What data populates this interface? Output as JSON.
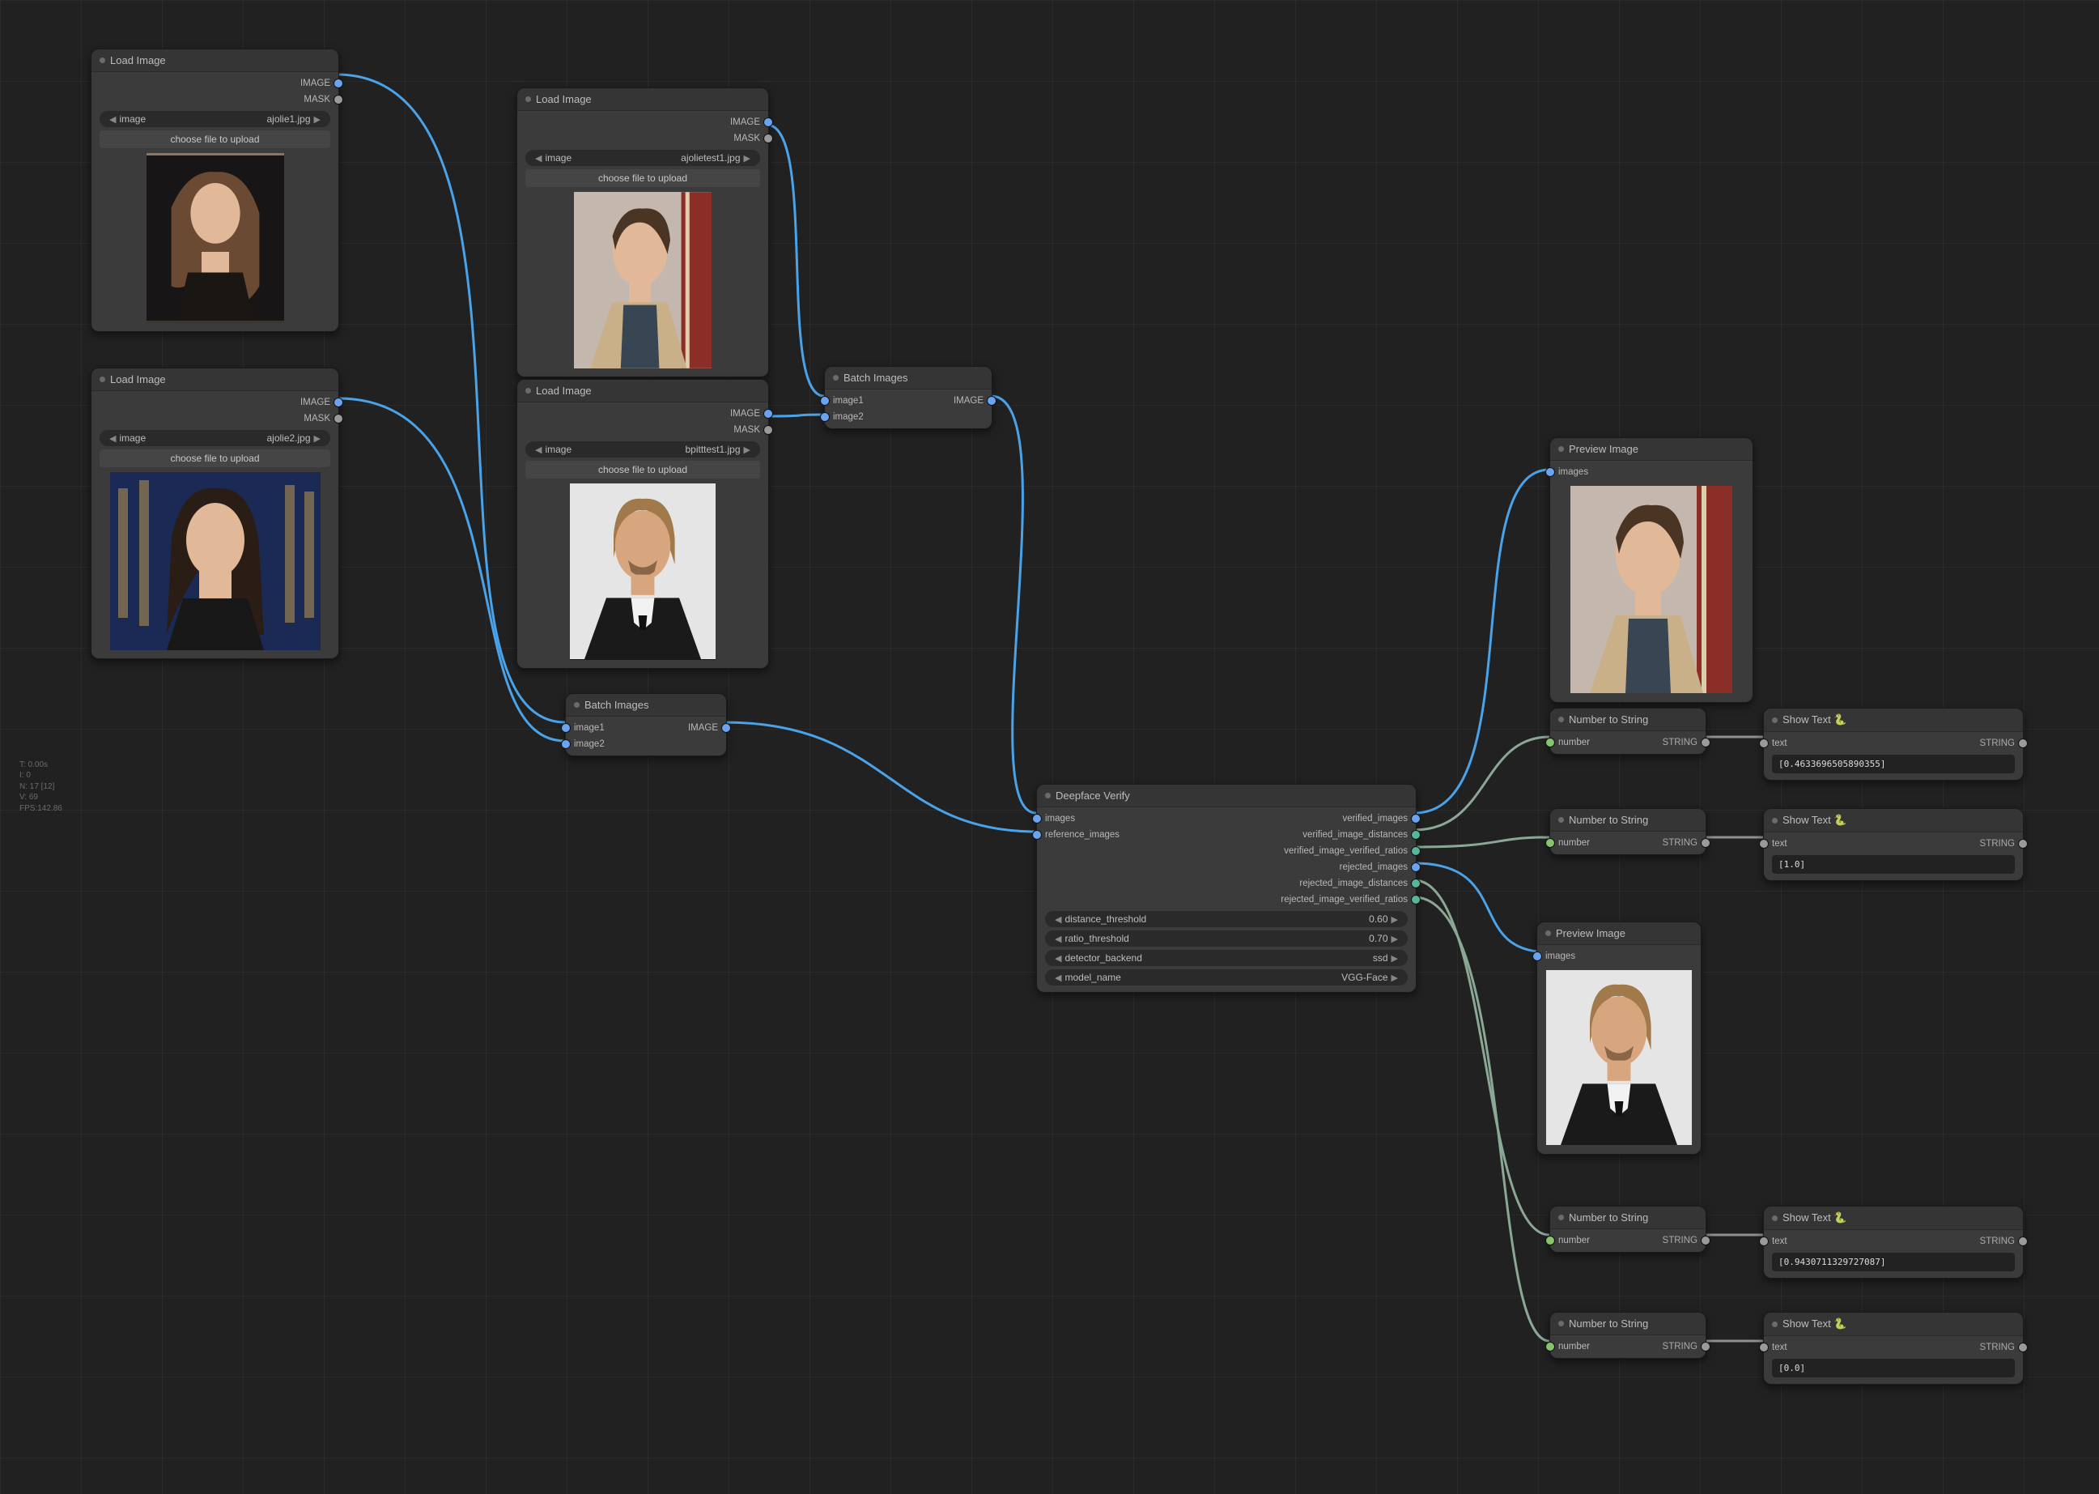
{
  "debug": {
    "t": "T: 0.00s",
    "i": "I: 0",
    "n": "N: 17 [12]",
    "v": "V: 69",
    "fps": "FPS:142.86"
  },
  "nodes": {
    "load1": {
      "title": "Load Image",
      "image_label": "image",
      "file": "ajolie1.jpg",
      "upload": "choose file to upload",
      "out_image": "IMAGE",
      "out_mask": "MASK"
    },
    "load2": {
      "title": "Load Image",
      "image_label": "image",
      "file": "ajolie2.jpg",
      "upload": "choose file to upload",
      "out_image": "IMAGE",
      "out_mask": "MASK"
    },
    "load3": {
      "title": "Load Image",
      "image_label": "image",
      "file": "ajolietest1.jpg",
      "upload": "choose file to upload",
      "out_image": "IMAGE",
      "out_mask": "MASK"
    },
    "load4": {
      "title": "Load Image",
      "image_label": "image",
      "file": "bpitttest1.jpg",
      "upload": "choose file to upload",
      "out_image": "IMAGE",
      "out_mask": "MASK"
    },
    "batch1": {
      "title": "Batch Images",
      "in1": "image1",
      "in2": "image2",
      "out": "IMAGE"
    },
    "batch2": {
      "title": "Batch Images",
      "in1": "image1",
      "in2": "image2",
      "out": "IMAGE"
    },
    "verify": {
      "title": "Deepface Verify",
      "in_images": "images",
      "in_ref": "reference_images",
      "out1": "verified_images",
      "out2": "verified_image_distances",
      "out3": "verified_image_verified_ratios",
      "out4": "rejected_images",
      "out5": "rejected_image_distances",
      "out6": "rejected_image_verified_ratios",
      "p1": {
        "label": "distance_threshold",
        "val": "0.60"
      },
      "p2": {
        "label": "ratio_threshold",
        "val": "0.70"
      },
      "p3": {
        "label": "detector_backend",
        "val": "ssd"
      },
      "p4": {
        "label": "model_name",
        "val": "VGG-Face"
      }
    },
    "prev1": {
      "title": "Preview Image",
      "in": "images"
    },
    "prev2": {
      "title": "Preview Image",
      "in": "images"
    },
    "n2s1": {
      "title": "Number to String",
      "in": "number",
      "out": "STRING"
    },
    "n2s2": {
      "title": "Number to String",
      "in": "number",
      "out": "STRING"
    },
    "n2s3": {
      "title": "Number to String",
      "in": "number",
      "out": "STRING"
    },
    "n2s4": {
      "title": "Number to String",
      "in": "number",
      "out": "STRING"
    },
    "show1": {
      "title": "Show Text 🐍",
      "in": "text",
      "out": "STRING",
      "val": "[0.4633696505890355]"
    },
    "show2": {
      "title": "Show Text 🐍",
      "in": "text",
      "out": "STRING",
      "val": "[1.0]"
    },
    "show3": {
      "title": "Show Text 🐍",
      "in": "text",
      "out": "STRING",
      "val": "[0.9430711329727087]"
    },
    "show4": {
      "title": "Show Text 🐍",
      "in": "text",
      "out": "STRING",
      "val": "[0.0]"
    }
  }
}
